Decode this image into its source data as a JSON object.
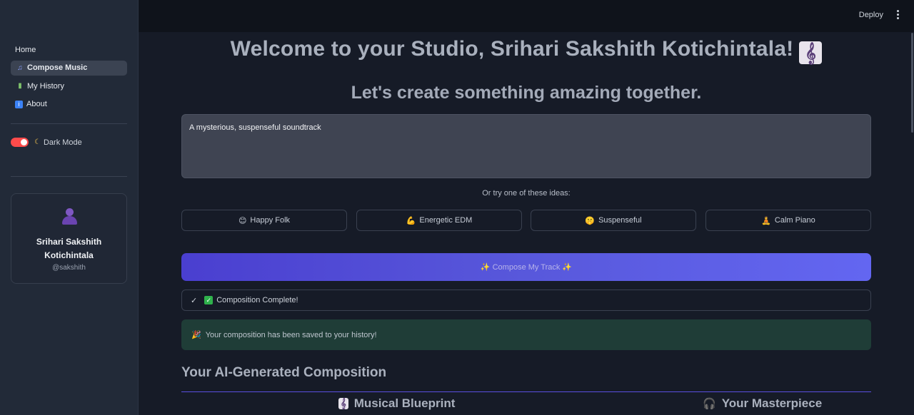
{
  "header": {
    "deploy_label": "Deploy"
  },
  "sidebar": {
    "items": [
      {
        "label": "Home",
        "icon": ""
      },
      {
        "label": "Compose Music",
        "icon": "music-note-icon"
      },
      {
        "label": "My History",
        "icon": "books-icon"
      },
      {
        "label": "About",
        "icon": "info-icon"
      }
    ],
    "dark_mode_label": "Dark Mode",
    "profile": {
      "name": "Srihari Sakshith Kotichintala",
      "handle": "@sakshith"
    }
  },
  "main": {
    "title": "Welcome to your Studio, Srihari Sakshith Kotichintala!",
    "subtitle": "Let's create something amazing together.",
    "prompt_value": "A mysterious, suspenseful soundtrack",
    "ideas_label": "Or try one of these ideas:",
    "ideas": [
      {
        "label": "Happy Folk",
        "icon": "😊"
      },
      {
        "label": "Energetic EDM",
        "icon": "💪"
      },
      {
        "label": "Suspenseful",
        "icon": "🤫"
      },
      {
        "label": "Calm Piano",
        "icon": "🧘"
      }
    ],
    "compose_label": "✨ Compose My Track ✨",
    "status_label": "Composition Complete!",
    "success_message": "Your composition has been saved to your history!",
    "section_title": "Your AI-Generated Composition",
    "col_left": "Musical Blueprint",
    "col_right": "Your Masterpiece"
  },
  "colors": {
    "accent": "#6366f1",
    "toggle": "#ff4b4b",
    "success_bg": "#1f3d37"
  }
}
